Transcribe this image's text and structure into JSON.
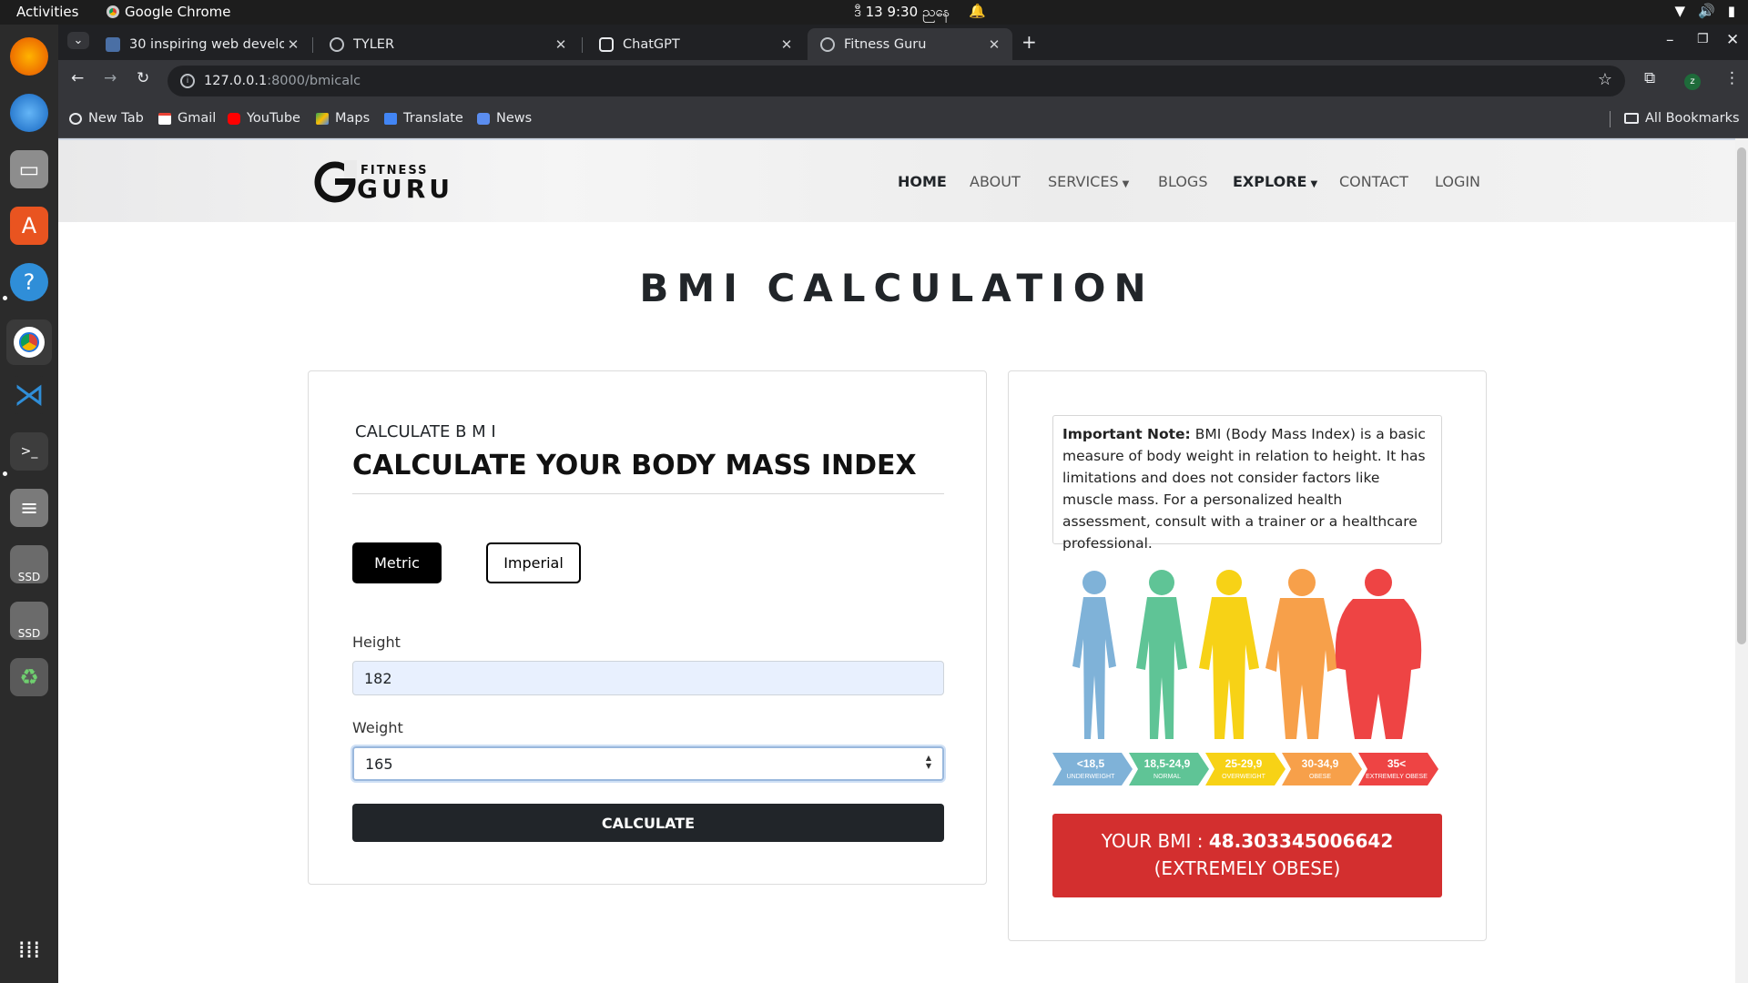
{
  "topbar": {
    "activities": "Activities",
    "app_name": "Google Chrome",
    "clock": "ဒီ 13  9:30 ညနေ"
  },
  "browser": {
    "tabs": [
      {
        "title": "30 inspiring web develop",
        "active": false
      },
      {
        "title": "TYLER",
        "active": false
      },
      {
        "title": "ChatGPT",
        "active": false
      },
      {
        "title": "Fitness Guru",
        "active": true
      }
    ],
    "url_host": "127.0.0.1",
    "url_path": ":8000/bmicalc",
    "profile_initial": "z",
    "bookmarks": [
      "New Tab",
      "Gmail",
      "YouTube",
      "Maps",
      "Translate",
      "News"
    ],
    "all_bookmarks": "All Bookmarks"
  },
  "site": {
    "logo_top": "FITNESS",
    "logo_bottom": "GURU",
    "nav": [
      "HOME",
      "ABOUT",
      "SERVICES",
      "BLOGS",
      "EXPLORE",
      "CONTACT",
      "LOGIN"
    ]
  },
  "page": {
    "title": "BMI CALCULATION",
    "form": {
      "subtitle": "CALCULATE  B M I",
      "heading": "CALCULATE YOUR BODY MASS INDEX",
      "metric_label": "Metric",
      "imperial_label": "Imperial",
      "height_label": "Height",
      "height_value": "182",
      "weight_label": "Weight",
      "weight_value": "165",
      "calculate_label": "CALCULATE"
    },
    "note": {
      "label": "Important Note:",
      "text": " BMI (Body Mass Index) is a basic measure of body weight in relation to height. It has limitations and does not consider factors like muscle mass. For a personalized health assessment, consult with a trainer or a healthcare professional."
    },
    "bmi_chart": [
      {
        "range": "<18,5",
        "label": "UNDERWEIGHT",
        "color": "#7fb2d8"
      },
      {
        "range": "18,5-24,9",
        "label": "NORMAL",
        "color": "#5fc496"
      },
      {
        "range": "25-29,9",
        "label": "OVERWEIGHT",
        "color": "#f7d216"
      },
      {
        "range": "30-34,9",
        "label": "OBESE",
        "color": "#f7a04a"
      },
      {
        "range": "35<",
        "label": "EXTREMELY OBESE",
        "color": "#ee4444"
      }
    ],
    "result": {
      "prefix": "YOUR BMI : ",
      "value": "48.303345006642",
      "category": "(EXTREMELY OBESE)"
    }
  }
}
